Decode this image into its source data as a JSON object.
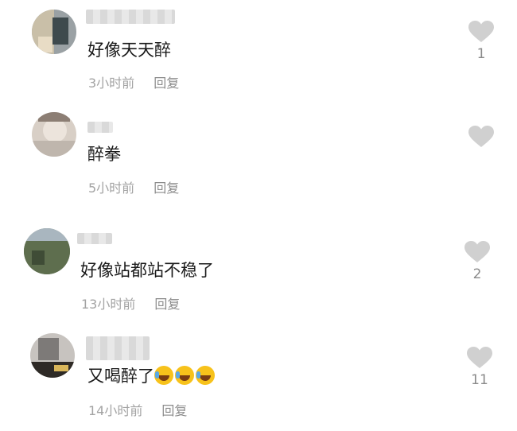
{
  "comments": [
    {
      "username": "用户",
      "text": "好像天天醉",
      "time": "3小时前",
      "reply": "回复",
      "likes": "1"
    },
    {
      "username": "用户",
      "text": "醉拳",
      "time": "5小时前",
      "reply": "回复",
      "likes": ""
    },
    {
      "username": "用户",
      "text": "好像站都站不稳了",
      "time": "13小时前",
      "reply": "回复",
      "likes": "2"
    },
    {
      "username": "用户",
      "text": "又喝醉了",
      "time": "14小时前",
      "reply": "回复",
      "likes": "11",
      "emojis": [
        "rolling-laughing-emoji",
        "rolling-laughing-emoji",
        "rolling-laughing-emoji"
      ]
    }
  ],
  "icons": {
    "like": "heart-icon"
  },
  "colors": {
    "heart": "#d0d0d0",
    "meta": "#a3a3a3",
    "text": "#1a1a1a"
  }
}
